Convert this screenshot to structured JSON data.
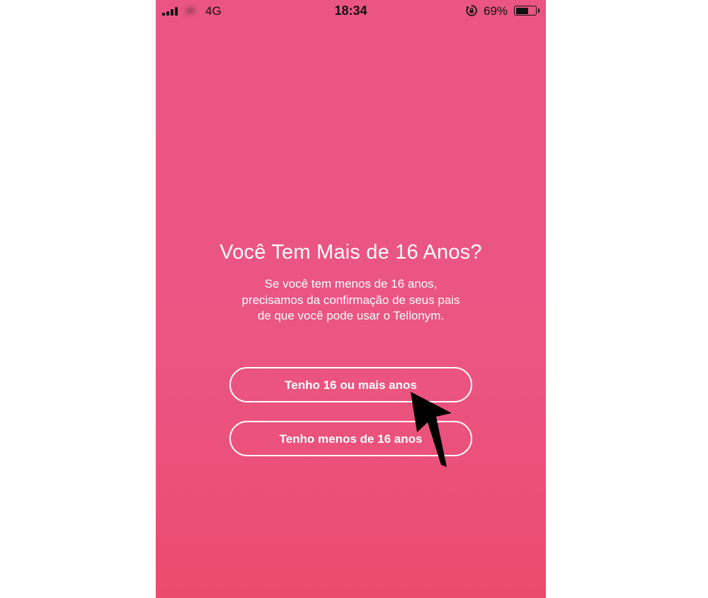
{
  "status_bar": {
    "network": "4G",
    "time": "18:34",
    "battery_percent": "69%",
    "battery_level": 0.69,
    "signal_bars": 4,
    "icons": [
      "signal-icon",
      "rotation-lock-icon",
      "battery-icon"
    ]
  },
  "screen": {
    "title": "Você Tem Mais de 16 Anos?",
    "description": "Se você tem menos de 16 anos, precisamos da confirmação de seus pais de que você pode usar o Tellonym.",
    "buttons": {
      "over_16": "Tenho 16 ou mais anos",
      "under_16": "Tenho menos de 16 anos"
    }
  },
  "annotation": {
    "icon": "pointer-arrow-icon",
    "color": "#000000"
  },
  "colors": {
    "background_top": "#ea5586",
    "background_bottom": "#eb4b6e",
    "text": "#ffffff"
  }
}
